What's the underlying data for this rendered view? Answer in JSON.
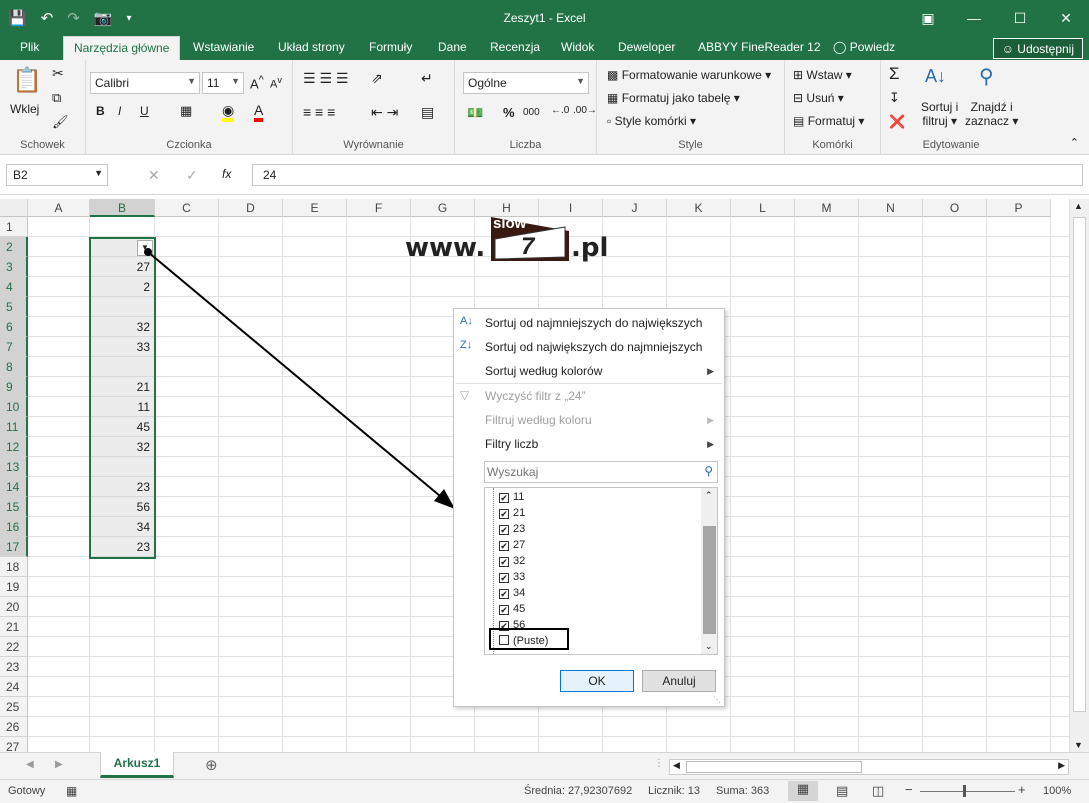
{
  "window": {
    "title": "Zeszyt1 - Excel"
  },
  "tabs": [
    "Plik",
    "Narzędzia główne",
    "Wstawianie",
    "Układ strony",
    "Formuły",
    "Dane",
    "Recenzja",
    "Widok",
    "Deweloper",
    "ABBYY FineReader 12",
    "Powiedz"
  ],
  "share_label": "Udostępnij",
  "ribbon": {
    "paste_label": "Wklej",
    "clipboard_label": "Schowek",
    "font_name": "Calibri",
    "font_size": "11",
    "font_label": "Czcionka",
    "align_label": "Wyrównanie",
    "number_format": "Ogólne",
    "number_label": "Liczba",
    "cond_format": "Formatowanie warunkowe",
    "format_table": "Formatuj jako tabelę",
    "cell_styles": "Style komórki",
    "style_label": "Style",
    "insert": "Wstaw",
    "delete": "Usuń",
    "format": "Formatuj",
    "cells_label": "Komórki",
    "sort_filter_1": "Sortuj i",
    "sort_filter_2": "filtruj",
    "find_select_1": "Znajdź i",
    "find_select_2": "zaznacz",
    "editing_label": "Edytowanie"
  },
  "formula": {
    "namebox": "B2",
    "content": "24"
  },
  "columns": [
    "A",
    "B",
    "C",
    "D",
    "E",
    "F",
    "G",
    "H",
    "I",
    "J",
    "K",
    "L",
    "M",
    "N",
    "O",
    "P"
  ],
  "rows": [
    "1",
    "2",
    "3",
    "4",
    "5",
    "6",
    "7",
    "8",
    "9",
    "10",
    "11",
    "12",
    "13",
    "14",
    "15",
    "16",
    "17",
    "18",
    "19",
    "20",
    "21",
    "22",
    "23",
    "24",
    "25",
    "26",
    "27"
  ],
  "cells_b": [
    "",
    "",
    "27",
    "2",
    "",
    "32",
    "33",
    "",
    "21",
    "11",
    "45",
    "32",
    "",
    "23",
    "56",
    "34",
    "23"
  ],
  "watermark": {
    "pre": "www.",
    "tag": "slow",
    "num": "7",
    "post": ".pl"
  },
  "menu": {
    "sort_asc": "Sortuj od najmniejszych do największych",
    "sort_desc": "Sortuj od największych do najmniejszych",
    "sort_color": "Sortuj według kolorów",
    "clear_filter": "Wyczyść filtr z „24”",
    "filter_color": "Filtruj według koloru",
    "number_filters": "Filtry liczb",
    "search_placeholder": "Wyszukaj",
    "items": [
      "11",
      "21",
      "23",
      "27",
      "32",
      "33",
      "34",
      "45",
      "56"
    ],
    "blank": "(Puste)",
    "ok": "OK",
    "cancel": "Anuluj"
  },
  "sheet": {
    "name": "Arkusz1"
  },
  "status": {
    "ready": "Gotowy",
    "average": "Średnia: 27,92307692",
    "count": "Licznik: 13",
    "sum": "Suma: 363",
    "zoom": "100%"
  }
}
